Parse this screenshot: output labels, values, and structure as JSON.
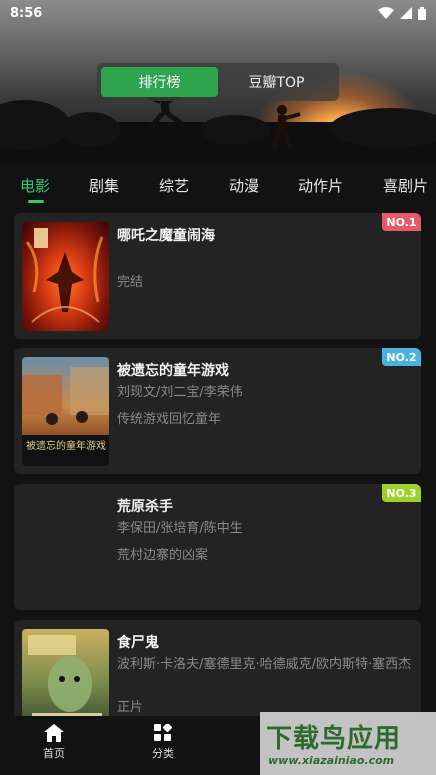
{
  "status_bar": {
    "time": "8:56"
  },
  "header": {
    "toggle": [
      {
        "label": "排行榜",
        "active": true
      },
      {
        "label": "豆瓣TOP",
        "active": false
      }
    ]
  },
  "tabs": [
    {
      "label": "电影",
      "active": true
    },
    {
      "label": "剧集",
      "active": false
    },
    {
      "label": "综艺",
      "active": false
    },
    {
      "label": "动漫",
      "active": false
    },
    {
      "label": "动作片",
      "active": false
    },
    {
      "label": "喜剧片",
      "active": false
    }
  ],
  "movies": [
    {
      "rank": "NO.1",
      "title": "哪吒之魔童闹海",
      "cast": "",
      "desc": "完结",
      "badge_color": "#e85a6a"
    },
    {
      "rank": "NO.2",
      "title": "被遗忘的童年游戏",
      "cast": "刘现文/刘二宝/李荣伟",
      "desc": "传统游戏回忆童年",
      "badge_color": "#4ab3e0"
    },
    {
      "rank": "NO.3",
      "title": "荒原杀手",
      "cast": "李保田/张培育/陈中生",
      "desc": "荒村边寨的凶案",
      "badge_color": "#9ed12a"
    },
    {
      "rank": "",
      "title": "食尸鬼",
      "cast": "波利斯·卡洛夫/塞德里克·哈德威克/欧内斯特·塞西杰",
      "desc": "正片",
      "badge_color": ""
    }
  ],
  "posters": {
    "p2_caption": "被遗忘的童年游戏"
  },
  "bottom_nav": [
    {
      "label": "首页",
      "icon": "home-icon"
    },
    {
      "label": "分类",
      "icon": "category-icon"
    }
  ],
  "watermark": {
    "big": "下载鸟应用",
    "small": "www.xiazainiao.com"
  }
}
